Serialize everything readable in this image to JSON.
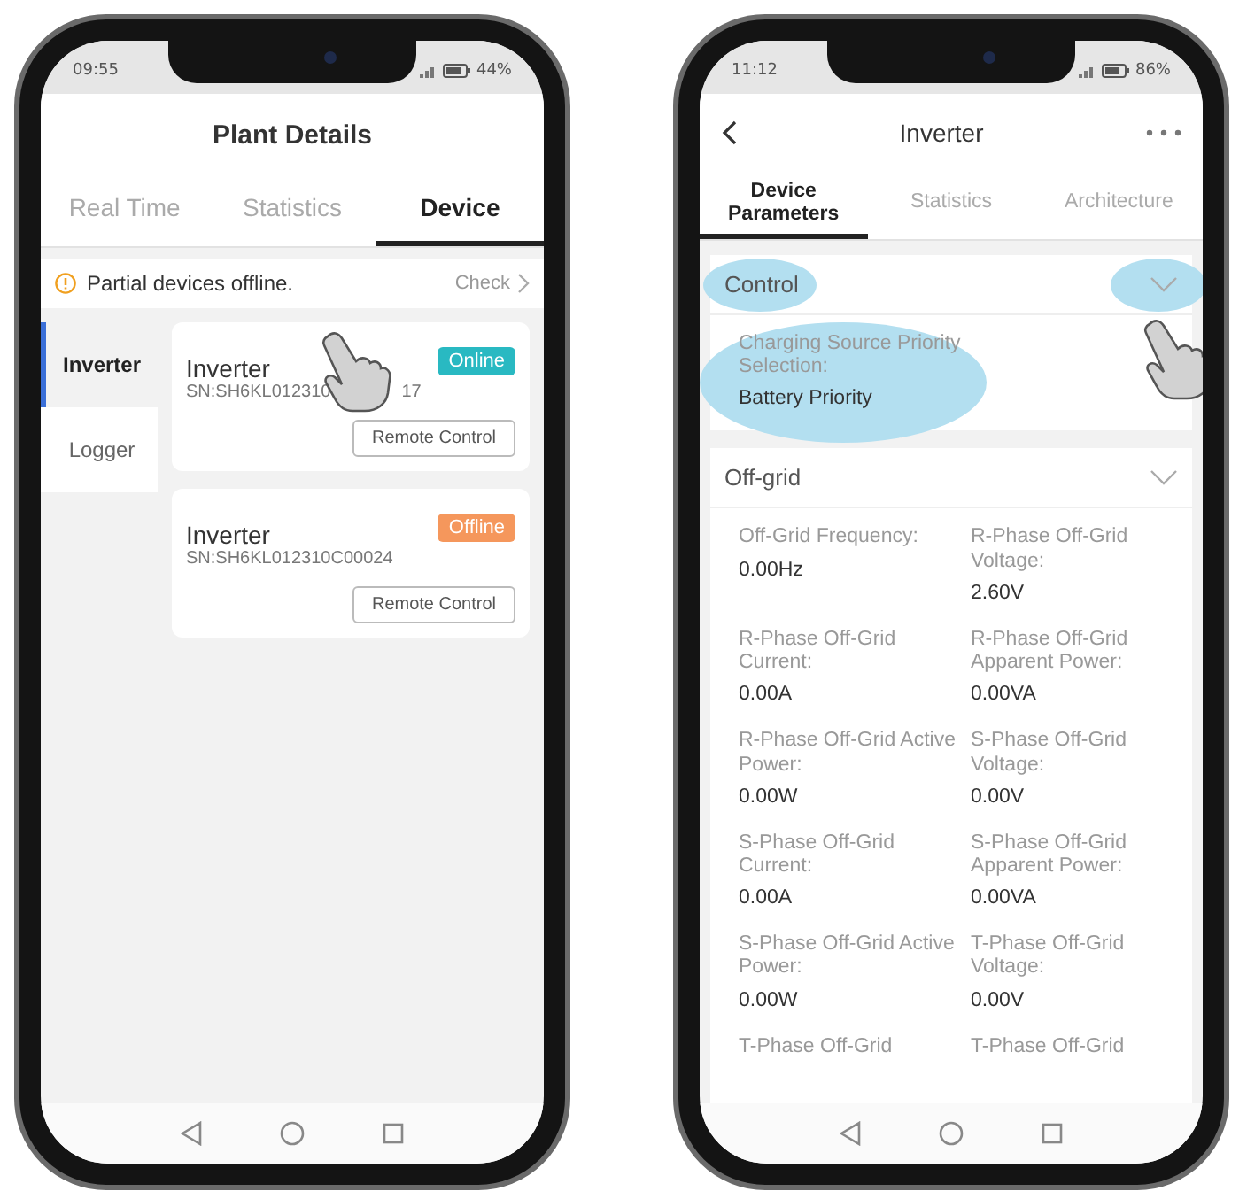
{
  "plant_screen": {
    "status_bar": {
      "time": "09:55",
      "battery": "44%"
    },
    "title": "Plant Details",
    "tabs": [
      {
        "label": "Real Time",
        "selected": false
      },
      {
        "label": "Statistics",
        "selected": false
      },
      {
        "label": "Device",
        "selected": true
      }
    ],
    "alert": {
      "message": "Partial devices offline.",
      "action": "Check"
    },
    "sidebar": [
      {
        "label": "Inverter",
        "selected": true
      },
      {
        "label": "Logger",
        "selected": false
      }
    ],
    "devices": [
      {
        "name": "Inverter",
        "serial": "SN:SH6KL012310",
        "serial_tail": "17",
        "status": "Online",
        "color": "#29b9c2",
        "button": "Remote Control",
        "pointer": true
      },
      {
        "name": "Inverter",
        "serial": "SN:SH6KL012310C00024",
        "status": "Offline",
        "color": "#f5975c",
        "button": "Remote Control",
        "pointer": false
      }
    ]
  },
  "inverter_screen": {
    "status_bar": {
      "time": "11:12",
      "battery": "86%"
    },
    "title": "Inverter",
    "tabs": [
      {
        "label": "Device Parameters",
        "selected": true
      },
      {
        "label": "Statistics",
        "selected": false
      },
      {
        "label": "Architecture",
        "selected": false
      }
    ],
    "control": {
      "title": "Control",
      "field_label": "Charging Source Priority Selection:",
      "field_value": "Battery Priority",
      "highlighted": true
    },
    "off_grid": {
      "title": "Off-grid",
      "params": [
        {
          "label": "Off-Grid Frequency:",
          "value": "0.00Hz"
        },
        {
          "label": "R-Phase Off-Grid Voltage:",
          "value": "2.60V"
        },
        {
          "label": "R-Phase Off-Grid Current:",
          "value": "0.00A"
        },
        {
          "label": "R-Phase Off-Grid Apparent Power:",
          "value": "0.00VA"
        },
        {
          "label": "R-Phase Off-Grid Active Power:",
          "value": "0.00W"
        },
        {
          "label": "S-Phase Off-Grid Voltage:",
          "value": "0.00V"
        },
        {
          "label": "S-Phase Off-Grid Current:",
          "value": "0.00A"
        },
        {
          "label": "S-Phase Off-Grid Apparent Power:",
          "value": "0.00VA"
        },
        {
          "label": "S-Phase Off-Grid Active Power:",
          "value": "0.00W"
        },
        {
          "label": "T-Phase Off-Grid Voltage:",
          "value": "0.00V"
        },
        {
          "label": "T-Phase Off-Grid"
        },
        {
          "label": "T-Phase Off-Grid"
        }
      ]
    }
  }
}
